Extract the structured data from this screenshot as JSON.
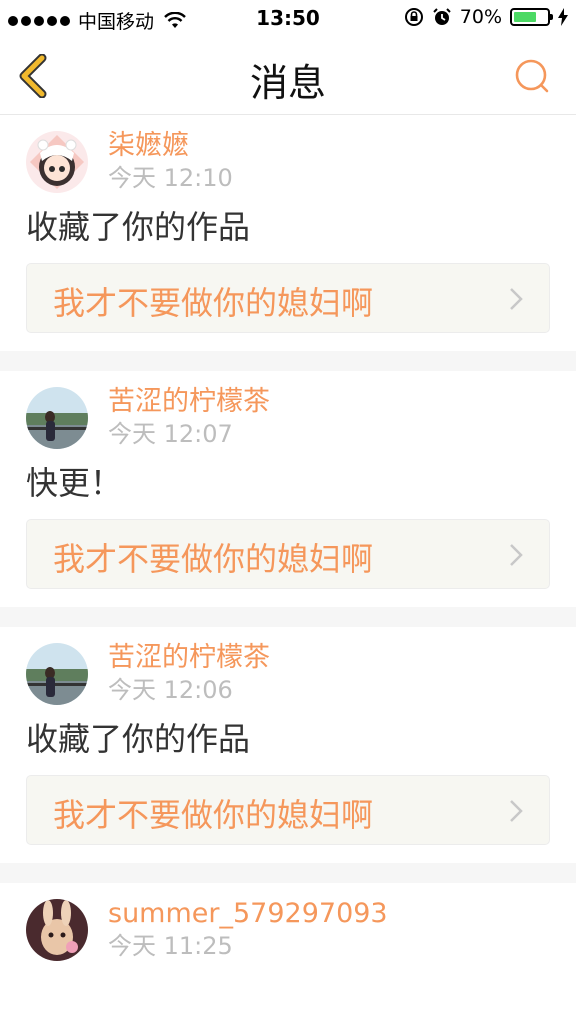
{
  "status": {
    "carrier": "中国移动",
    "time": "13:50",
    "battery": "70%",
    "battery_level": 0.7
  },
  "nav": {
    "title": "消息"
  },
  "colors": {
    "accent": "#f5975b",
    "back_arrow": "#f1b92d",
    "muted": "#bdbdbd"
  },
  "messages": [
    {
      "user": "柒嬷嬷",
      "time": "今天 12:10",
      "content": "收藏了你的作品",
      "work": "我才不要做你的媳妇啊"
    },
    {
      "user": "苦涩的柠檬茶",
      "time": "今天 12:07",
      "content": "快更！",
      "work": "我才不要做你的媳妇啊"
    },
    {
      "user": "苦涩的柠檬茶",
      "time": "今天 12:06",
      "content": "收藏了你的作品",
      "work": "我才不要做你的媳妇啊"
    },
    {
      "user": "summer_579297093",
      "time": "今天 11:25"
    }
  ]
}
